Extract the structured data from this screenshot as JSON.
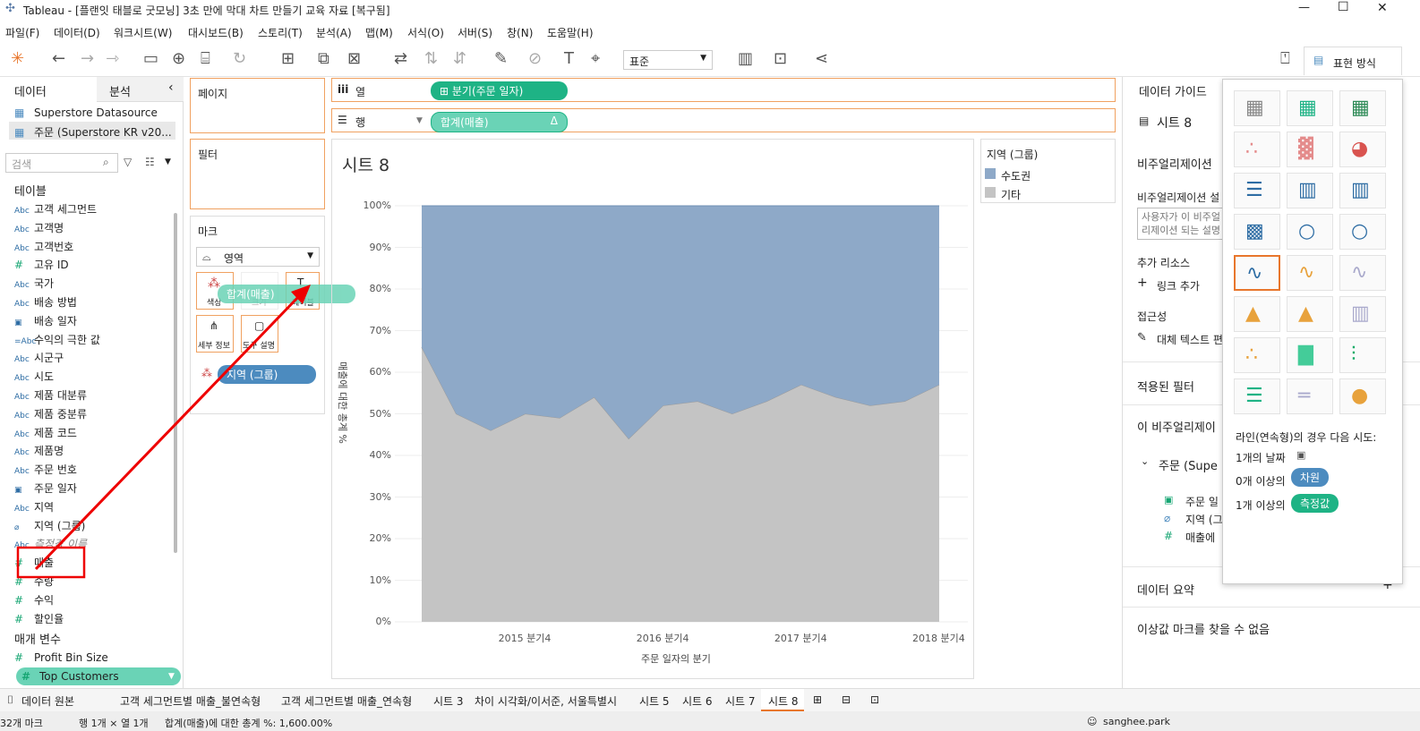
{
  "window": {
    "title": "Tableau - [플랜잇 태블로 굿모닝] 3초 만에 막대 차트 만들기 교육 자료 [복구됨]",
    "min": "—",
    "max": "☐",
    "close": "✕"
  },
  "menu": [
    "파일(F)",
    "데이터(D)",
    "워크시트(W)",
    "대시보드(B)",
    "스토리(T)",
    "분석(A)",
    "맵(M)",
    "서식(O)",
    "서버(S)",
    "창(N)",
    "도움말(H)"
  ],
  "toolbar": {
    "fit": "표준",
    "show_me": "표현 방식"
  },
  "leftpane": {
    "tab_data": "데이터",
    "tab_analysis": "분석",
    "sources": [
      "Superstore Datasource",
      "주문 (Superstore KR v20..."
    ],
    "search_placeholder": "검색",
    "tables_header": "테이블",
    "fields": [
      {
        "t": "Abc",
        "n": "고객 세그먼트"
      },
      {
        "t": "Abc",
        "n": "고객명"
      },
      {
        "t": "Abc",
        "n": "고객번호"
      },
      {
        "t": "#",
        "n": "고유 ID"
      },
      {
        "t": "Abc",
        "n": "국가"
      },
      {
        "t": "Abc",
        "n": "배송 방법"
      },
      {
        "t": "cal",
        "n": "배송 일자"
      },
      {
        "t": "=Abc",
        "n": "수익의 극한 값"
      },
      {
        "t": "Abc",
        "n": "시군구"
      },
      {
        "t": "Abc",
        "n": "시도"
      },
      {
        "t": "Abc",
        "n": "제품 대분류"
      },
      {
        "t": "Abc",
        "n": "제품 중분류"
      },
      {
        "t": "Abc",
        "n": "제품 코드"
      },
      {
        "t": "Abc",
        "n": "제품명"
      },
      {
        "t": "Abc",
        "n": "주문 번호"
      },
      {
        "t": "cal",
        "n": "주문 일자"
      },
      {
        "t": "Abc",
        "n": "지역"
      },
      {
        "t": "clip",
        "n": "지역 (그룹)"
      },
      {
        "t": "Abc",
        "n": "측정값 이름"
      },
      {
        "t": "#",
        "n": "매출"
      },
      {
        "t": "#",
        "n": "수량"
      },
      {
        "t": "#",
        "n": "수익"
      },
      {
        "t": "#",
        "n": "할인율"
      }
    ],
    "params_header": "매개 변수",
    "params": [
      "Profit Bin Size",
      "Top Customers"
    ]
  },
  "shelves": {
    "pages": "페이지",
    "filters": "필터",
    "marks": "마크",
    "mark_type": "영역",
    "mark_cards": [
      "색상",
      "크기",
      "레이블",
      "세부 정보",
      "도구 설명"
    ],
    "drag_pill": "합계(매출)",
    "color_pill": "지역 (그룹)",
    "columns_label": "열",
    "rows_label": "행",
    "columns_pill": "분기(주문 일자)",
    "rows_pill": "합계(매출)",
    "rows_pill_delta": "Δ"
  },
  "chart_data": {
    "type": "area",
    "title": "시트 8",
    "xlabel": "주문 일자의 분기",
    "ylabel": "매출에 대한 총계 %",
    "x_ticks": [
      "2015 분기4",
      "2016 분기4",
      "2017 분기4",
      "2018 분기4"
    ],
    "y_ticks": [
      "100%",
      "90%",
      "80%",
      "70%",
      "60%",
      "50%",
      "40%",
      "30%",
      "20%",
      "10%",
      "0%"
    ],
    "ylim": [
      0,
      100
    ],
    "stacked": true,
    "x": [
      "2015 분기1",
      "2015 분기2",
      "2015 분기3",
      "2015 분기4",
      "2016 분기1",
      "2016 분기2",
      "2016 분기3",
      "2016 분기4",
      "2017 분기1",
      "2017 분기2",
      "2017 분기3",
      "2017 분기4",
      "2018 분기1",
      "2018 분기2",
      "2018 분기3",
      "2018 분기4"
    ],
    "series": [
      {
        "name": "기타",
        "color": "#c4c4c4",
        "values": [
          66,
          50,
          46,
          50,
          49,
          54,
          44,
          52,
          53,
          50,
          53,
          57,
          54,
          52,
          53,
          57
        ]
      },
      {
        "name": "수도권",
        "color": "#8ea9c8",
        "values": [
          34,
          50,
          54,
          50,
          51,
          46,
          56,
          48,
          47,
          50,
          47,
          43,
          46,
          48,
          47,
          43
        ]
      }
    ],
    "legend_title": "지역 (그룹)",
    "legend_position": "right"
  },
  "rightpane": {
    "tab": "데이터 가이드",
    "sheet": "시트 8",
    "viz_desc": "비주얼리제이션",
    "viz_desc_label": "비주얼리제이션 설",
    "desc_placeholder": "사용자가 이 비주얼리제이션 되는 설명을 입력",
    "resources": "추가 리소스",
    "add_link": "링크 추가",
    "accessibility": "접근성",
    "alt_text": "대체 텍스트 편",
    "applied_filters": "적용된 필터",
    "this_viz": "이 비주얼리제이",
    "source_tree": "주문 (Supe",
    "tree_items": [
      "주문 일",
      "지역 (그",
      "매출에 "
    ],
    "data_summary": "데이터 요약",
    "outliers": "이상값 마크를 찾을 수 없음"
  },
  "showme": {
    "hint": "라인(연속형)의 경우 다음 시도:",
    "l1": "1개의 날짜",
    "l2a": "0개 이상의",
    "l2b": "차원",
    "l3a": "1개 이상의",
    "l3b": "측정값"
  },
  "sheettabs": [
    "데이터 원본",
    "고객 세그먼트별 매출_불연속형",
    "고객 세그먼트별 매출_연속형",
    "시트 3",
    "차이 시각화/이서준, 서울특별시",
    "시트 5",
    "시트 6",
    "시트 7",
    "시트 8"
  ],
  "status": {
    "marks": "32개 마크",
    "rows": "행 1개 × 열 1개",
    "sum": "합계(매출)에 대한 총계 %: 1,600.00%",
    "user": "sanghee.park"
  }
}
